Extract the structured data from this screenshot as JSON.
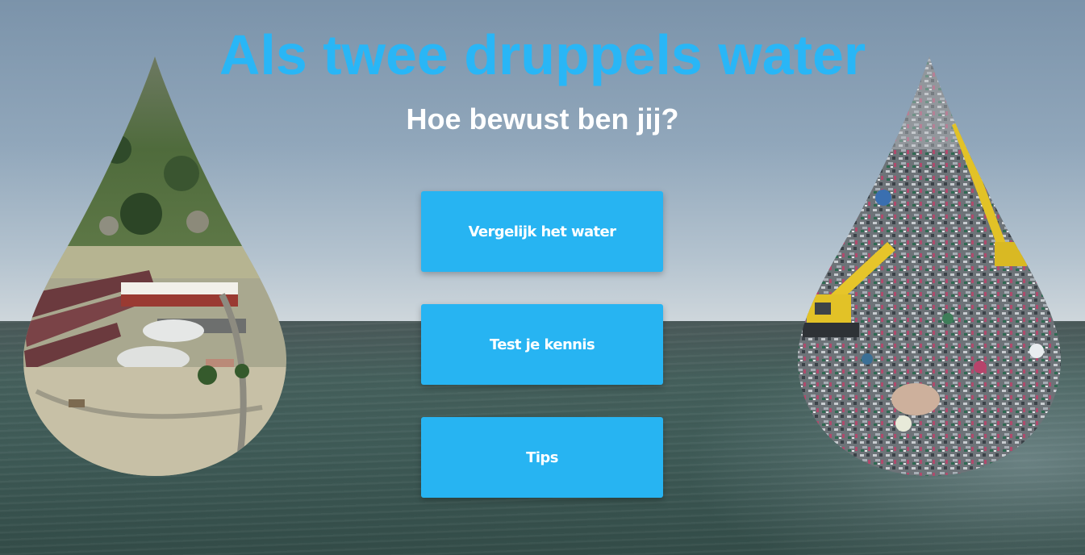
{
  "page": {
    "title": "Als twee druppels water",
    "subtitle": "Hoe bewust ben jij?"
  },
  "menu": {
    "buttons": [
      {
        "label": "Vergelijk het water"
      },
      {
        "label": "Test je kennis"
      },
      {
        "label": "Tips"
      }
    ]
  },
  "images": {
    "left_drop": "water-drop-treatment-plant-image",
    "right_drop": "water-drop-landfill-image"
  },
  "colors": {
    "title": "#29b6f6",
    "button": "#27b4f2",
    "button_text": "#ffffff",
    "subtitle": "#ffffff"
  }
}
